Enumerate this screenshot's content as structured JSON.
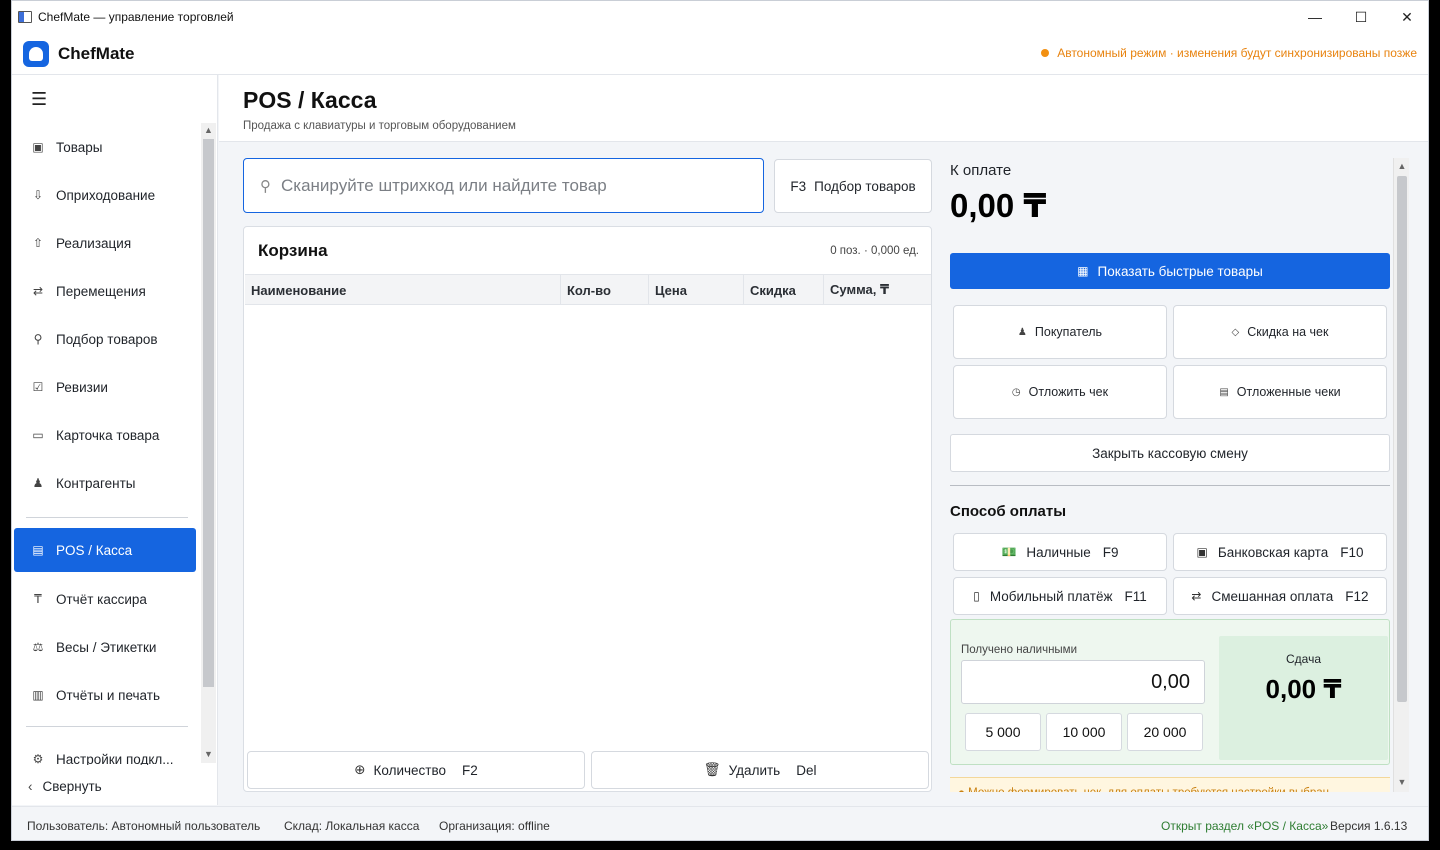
{
  "window": {
    "title": "ChefMate — управление торговлей",
    "min": "—",
    "max": "☐",
    "close": "✕"
  },
  "header": {
    "brand": "ChefMate",
    "offline_notice": "Автономный режим · изменения будут синхронизированы позже"
  },
  "sidebar": {
    "menu_icon": "☰",
    "items": [
      {
        "icon": "▣",
        "label": "Товары"
      },
      {
        "icon": "⇩",
        "label": "Оприходование"
      },
      {
        "icon": "⇧",
        "label": "Реализация"
      },
      {
        "icon": "⇄",
        "label": "Перемещения"
      },
      {
        "icon": "⚲",
        "label": "Подбор товаров"
      },
      {
        "icon": "☑",
        "label": "Ревизии"
      },
      {
        "icon": "▭",
        "label": "Карточка товара"
      },
      {
        "icon": "♟",
        "label": "Контрагенты"
      },
      {
        "icon": "▤",
        "label": "POS / Касса"
      },
      {
        "icon": "₸",
        "label": "Отчёт кассира"
      },
      {
        "icon": "⚖",
        "label": "Весы / Этикетки"
      },
      {
        "icon": "▥",
        "label": "Отчёты и печать"
      },
      {
        "icon": "⚙",
        "label": "Настройки подкл..."
      }
    ],
    "collapse_icon": "‹",
    "collapse_label": "Свернуть"
  },
  "page": {
    "title": "POS / Касса",
    "subtitle": "Продажа с клавиатуры и торговым оборудованием"
  },
  "search": {
    "icon": "⚲",
    "placeholder": "Сканируйте штрихкод или найдите товар",
    "value": ""
  },
  "pick_button": {
    "hotkey": "F3",
    "label": "Подбор товаров"
  },
  "cart": {
    "title": "Корзина",
    "count": "0 поз. · 0,000 ед.",
    "columns": [
      "Наименование",
      "Кол-во",
      "Цена",
      "Скидка",
      "Сумма, ₸"
    ],
    "rows": [],
    "qty_button": {
      "icon": "⊕",
      "label": "Количество",
      "hotkey": "F2"
    },
    "delete_button": {
      "icon": "🗑",
      "label": "Удалить",
      "hotkey": "Del"
    }
  },
  "payment": {
    "due_label": "К оплате",
    "due_total": "0,00 ₸",
    "quick_products": {
      "icon": "▦",
      "label": "Показать быстрые товары"
    },
    "actions": [
      {
        "icon": "♟",
        "label": "Покупатель"
      },
      {
        "icon": "◇",
        "label": "Скидка на чек"
      },
      {
        "icon": "◷",
        "label": "Отложить чек"
      },
      {
        "icon": "▤",
        "label": "Отложенные чеки"
      }
    ],
    "close_shift": "Закрыть кассовую смену",
    "method_title": "Способ оплаты",
    "methods": [
      {
        "icon": "💵",
        "label": "Наличные",
        "hotkey": "F9"
      },
      {
        "icon": "▣",
        "label": "Банковская карта",
        "hotkey": "F10"
      },
      {
        "icon": "▯",
        "label": "Мобильный платёж",
        "hotkey": "F11"
      },
      {
        "icon": "⇄",
        "label": "Смешанная оплата",
        "hotkey": "F12"
      }
    ],
    "cash_received_label": "Получено наличными",
    "cash_received_value": "0,00",
    "cash_quick": [
      "5 000",
      "10 000",
      "20 000"
    ],
    "change_label": "Сдача",
    "change_value": "0,00 ₸",
    "warning": "● Можно формировать чек, для оплаты требуются настройки выбран..."
  },
  "status": {
    "user": "Пользователь: Автономный пользователь",
    "warehouse": "Склад: Локальная касса",
    "org": "Организация: offline",
    "section": "Открыт раздел «POS / Касса»",
    "version": "Версия 1.6.13"
  },
  "colors": {
    "accent": "#1565e0",
    "offline": "#f29012",
    "status_ok": "#2e7d32",
    "change_bg": "#dcf0e0"
  }
}
